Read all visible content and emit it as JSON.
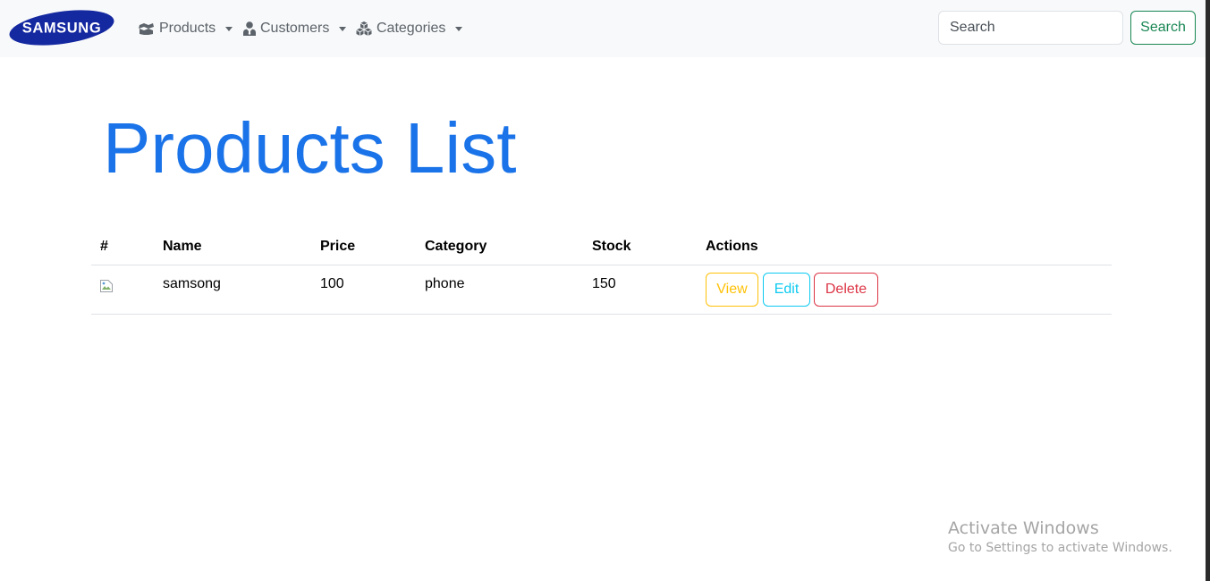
{
  "navbar": {
    "brand": "SAMSUNG",
    "items": [
      {
        "label": "Products",
        "icon": "boxes-icon"
      },
      {
        "label": "Customers",
        "icon": "user-tie-icon"
      },
      {
        "label": "Categories",
        "icon": "cubes-icon"
      }
    ],
    "search": {
      "placeholder": "Search",
      "value": "",
      "button_label": "Search"
    }
  },
  "page": {
    "title": "Products List"
  },
  "table": {
    "headers": [
      "#",
      "Name",
      "Price",
      "Category",
      "Stock",
      "Actions"
    ],
    "rows": [
      {
        "image": "broken-image-icon",
        "name": "samsong",
        "price": "100",
        "category": "phone",
        "stock": "150",
        "actions": {
          "view": "View",
          "edit": "Edit",
          "delete": "Delete"
        }
      }
    ]
  },
  "watermark": {
    "title": "Activate Windows",
    "subtitle": "Go to Settings to activate Windows."
  },
  "colors": {
    "title": "#1a73e8",
    "brand": "#1428a0",
    "search_button": "#198754",
    "view": "#ffc107",
    "edit": "#0dcaf0",
    "delete": "#dc3545",
    "navbar_bg": "#f8f9fa"
  }
}
